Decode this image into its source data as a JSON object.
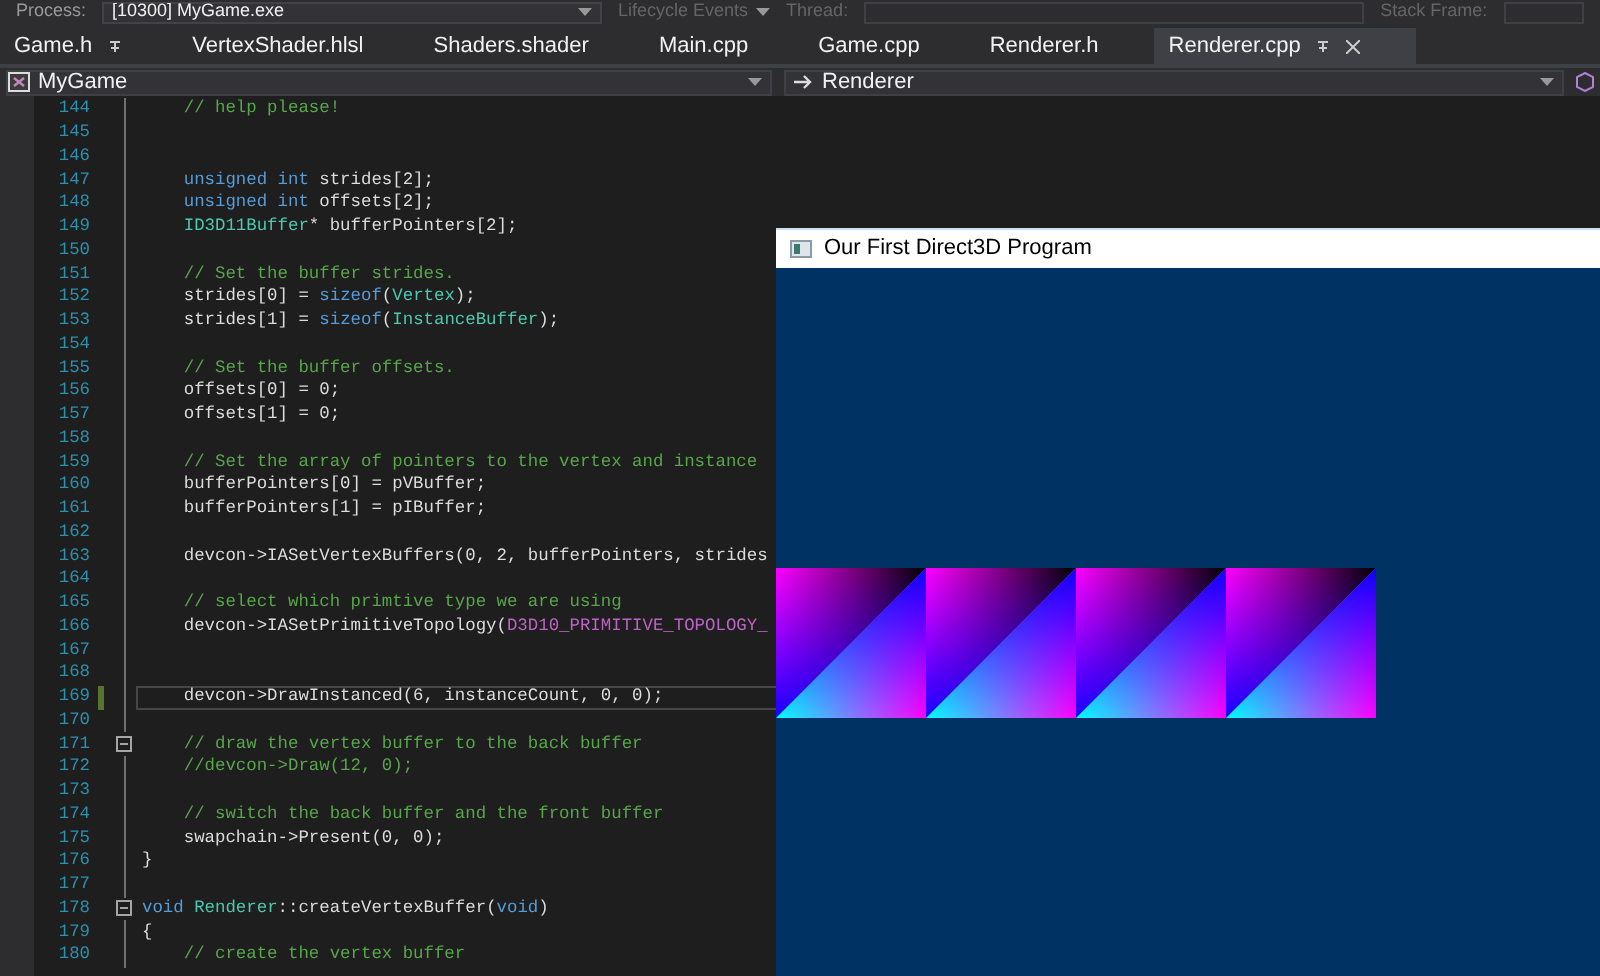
{
  "toolbar": {
    "process_label": "Process:",
    "process_value": "[10300] MyGame.exe",
    "lifecycle": "Lifecycle Events",
    "thread_label": "Thread:",
    "stack_label": "Stack Frame:"
  },
  "tabs": [
    {
      "label": "Game.h",
      "selected": false,
      "pinned": true
    },
    {
      "label": "VertexShader.hlsl",
      "selected": false,
      "pinned": false
    },
    {
      "label": "Shaders.shader",
      "selected": false,
      "pinned": false
    },
    {
      "label": "Main.cpp",
      "selected": false,
      "pinned": false
    },
    {
      "label": "Game.cpp",
      "selected": false,
      "pinned": false
    },
    {
      "label": "Renderer.h",
      "selected": false,
      "pinned": false
    },
    {
      "label": "Renderer.cpp",
      "selected": true,
      "pinned": true
    }
  ],
  "navigation": {
    "project": "MyGame",
    "scope": "Renderer"
  },
  "editor": {
    "lines": [
      {
        "number": "144",
        "segments": [
          {
            "text": "    // help please!",
            "kind": "comment"
          }
        ]
      },
      {
        "number": "145"
      },
      {
        "number": "146"
      },
      {
        "number": "147",
        "segments": [
          {
            "text": "    unsigned int",
            "kind": "keyword"
          },
          {
            "text": " strides[2];",
            "kind": "plain"
          }
        ]
      },
      {
        "number": "148",
        "segments": [
          {
            "text": "    unsigned int",
            "kind": "keyword"
          },
          {
            "text": " offsets[2];",
            "kind": "plain"
          }
        ]
      },
      {
        "number": "149",
        "segments": [
          {
            "text": "    ID3D11Buffer",
            "kind": "type"
          },
          {
            "text": "* bufferPointers[2];",
            "kind": "plain"
          }
        ]
      },
      {
        "number": "150"
      },
      {
        "number": "151",
        "segments": [
          {
            "text": "    // Set the buffer strides.",
            "kind": "comment"
          }
        ]
      },
      {
        "number": "152",
        "segments": [
          {
            "text": "    strides[0] = ",
            "kind": "plain"
          },
          {
            "text": "sizeof",
            "kind": "keyword"
          },
          {
            "text": "(",
            "kind": "plain"
          },
          {
            "text": "Vertex",
            "kind": "type"
          },
          {
            "text": ");",
            "kind": "plain"
          }
        ]
      },
      {
        "number": "153",
        "segments": [
          {
            "text": "    strides[1] = ",
            "kind": "plain"
          },
          {
            "text": "sizeof",
            "kind": "keyword"
          },
          {
            "text": "(",
            "kind": "plain"
          },
          {
            "text": "InstanceBuffer",
            "kind": "type"
          },
          {
            "text": ");",
            "kind": "plain"
          }
        ]
      },
      {
        "number": "154"
      },
      {
        "number": "155",
        "segments": [
          {
            "text": "    // Set the buffer offsets.",
            "kind": "comment"
          }
        ]
      },
      {
        "number": "156",
        "segments": [
          {
            "text": "    offsets[0] = 0;",
            "kind": "plain"
          }
        ]
      },
      {
        "number": "157",
        "segments": [
          {
            "text": "    offsets[1] = 0;",
            "kind": "plain"
          }
        ]
      },
      {
        "number": "158"
      },
      {
        "number": "159",
        "segments": [
          {
            "text": "    // Set the array of pointers to the vertex and instance",
            "kind": "comment"
          }
        ]
      },
      {
        "number": "160",
        "segments": [
          {
            "text": "    bufferPointers[0] = pVBuffer;",
            "kind": "plain"
          }
        ]
      },
      {
        "number": "161",
        "segments": [
          {
            "text": "    bufferPointers[1] = pIBuffer;",
            "kind": "plain"
          }
        ]
      },
      {
        "number": "162"
      },
      {
        "number": "163",
        "segments": [
          {
            "text": "    devcon->IASetVertexBuffers(0, 2, bufferPointers, strides",
            "kind": "plain"
          }
        ]
      },
      {
        "number": "164"
      },
      {
        "number": "165",
        "segments": [
          {
            "text": "    // select which primtive type we are using",
            "kind": "comment"
          }
        ]
      },
      {
        "number": "166",
        "segments": [
          {
            "text": "    devcon->IASetPrimitiveTopology(",
            "kind": "plain"
          },
          {
            "text": "D3D10_PRIMITIVE_TOPOLOGY_",
            "kind": "macro"
          }
        ]
      },
      {
        "number": "167"
      },
      {
        "number": "168"
      },
      {
        "number": "169",
        "selected": true,
        "modified": true,
        "segments": [
          {
            "text": "    devcon->DrawInstanced(6, instanceCount, 0, 0);",
            "kind": "plain"
          }
        ]
      },
      {
        "number": "170"
      },
      {
        "number": "171",
        "collapsible": true,
        "segments": [
          {
            "text": "    // draw the vertex buffer to the back buffer",
            "kind": "comment"
          }
        ]
      },
      {
        "number": "172",
        "segments": [
          {
            "text": "    //devcon->Draw(12, 0);",
            "kind": "comment"
          }
        ]
      },
      {
        "number": "173"
      },
      {
        "number": "174",
        "segments": [
          {
            "text": "    // switch the back buffer and the front buffer",
            "kind": "comment"
          }
        ]
      },
      {
        "number": "175",
        "segments": [
          {
            "text": "    swapchain->Present(0, 0);",
            "kind": "plain"
          }
        ]
      },
      {
        "number": "176",
        "segments": [
          {
            "text": "}",
            "kind": "plain"
          }
        ]
      },
      {
        "number": "177"
      },
      {
        "number": "178",
        "collapsible": true,
        "segments": [
          {
            "text": "void ",
            "kind": "keyword"
          },
          {
            "text": "Renderer",
            "kind": "type"
          },
          {
            "text": "::createVertexBuffer(",
            "kind": "plain"
          },
          {
            "text": "void",
            "kind": "keyword"
          },
          {
            "text": ")",
            "kind": "plain"
          }
        ]
      },
      {
        "number": "179",
        "segments": [
          {
            "text": "{",
            "kind": "plain"
          }
        ]
      },
      {
        "number": "180",
        "segments": [
          {
            "text": "    // create the vertex buffer",
            "kind": "comment"
          }
        ]
      }
    ]
  },
  "app_window": {
    "title": "Our First Direct3D Program"
  }
}
